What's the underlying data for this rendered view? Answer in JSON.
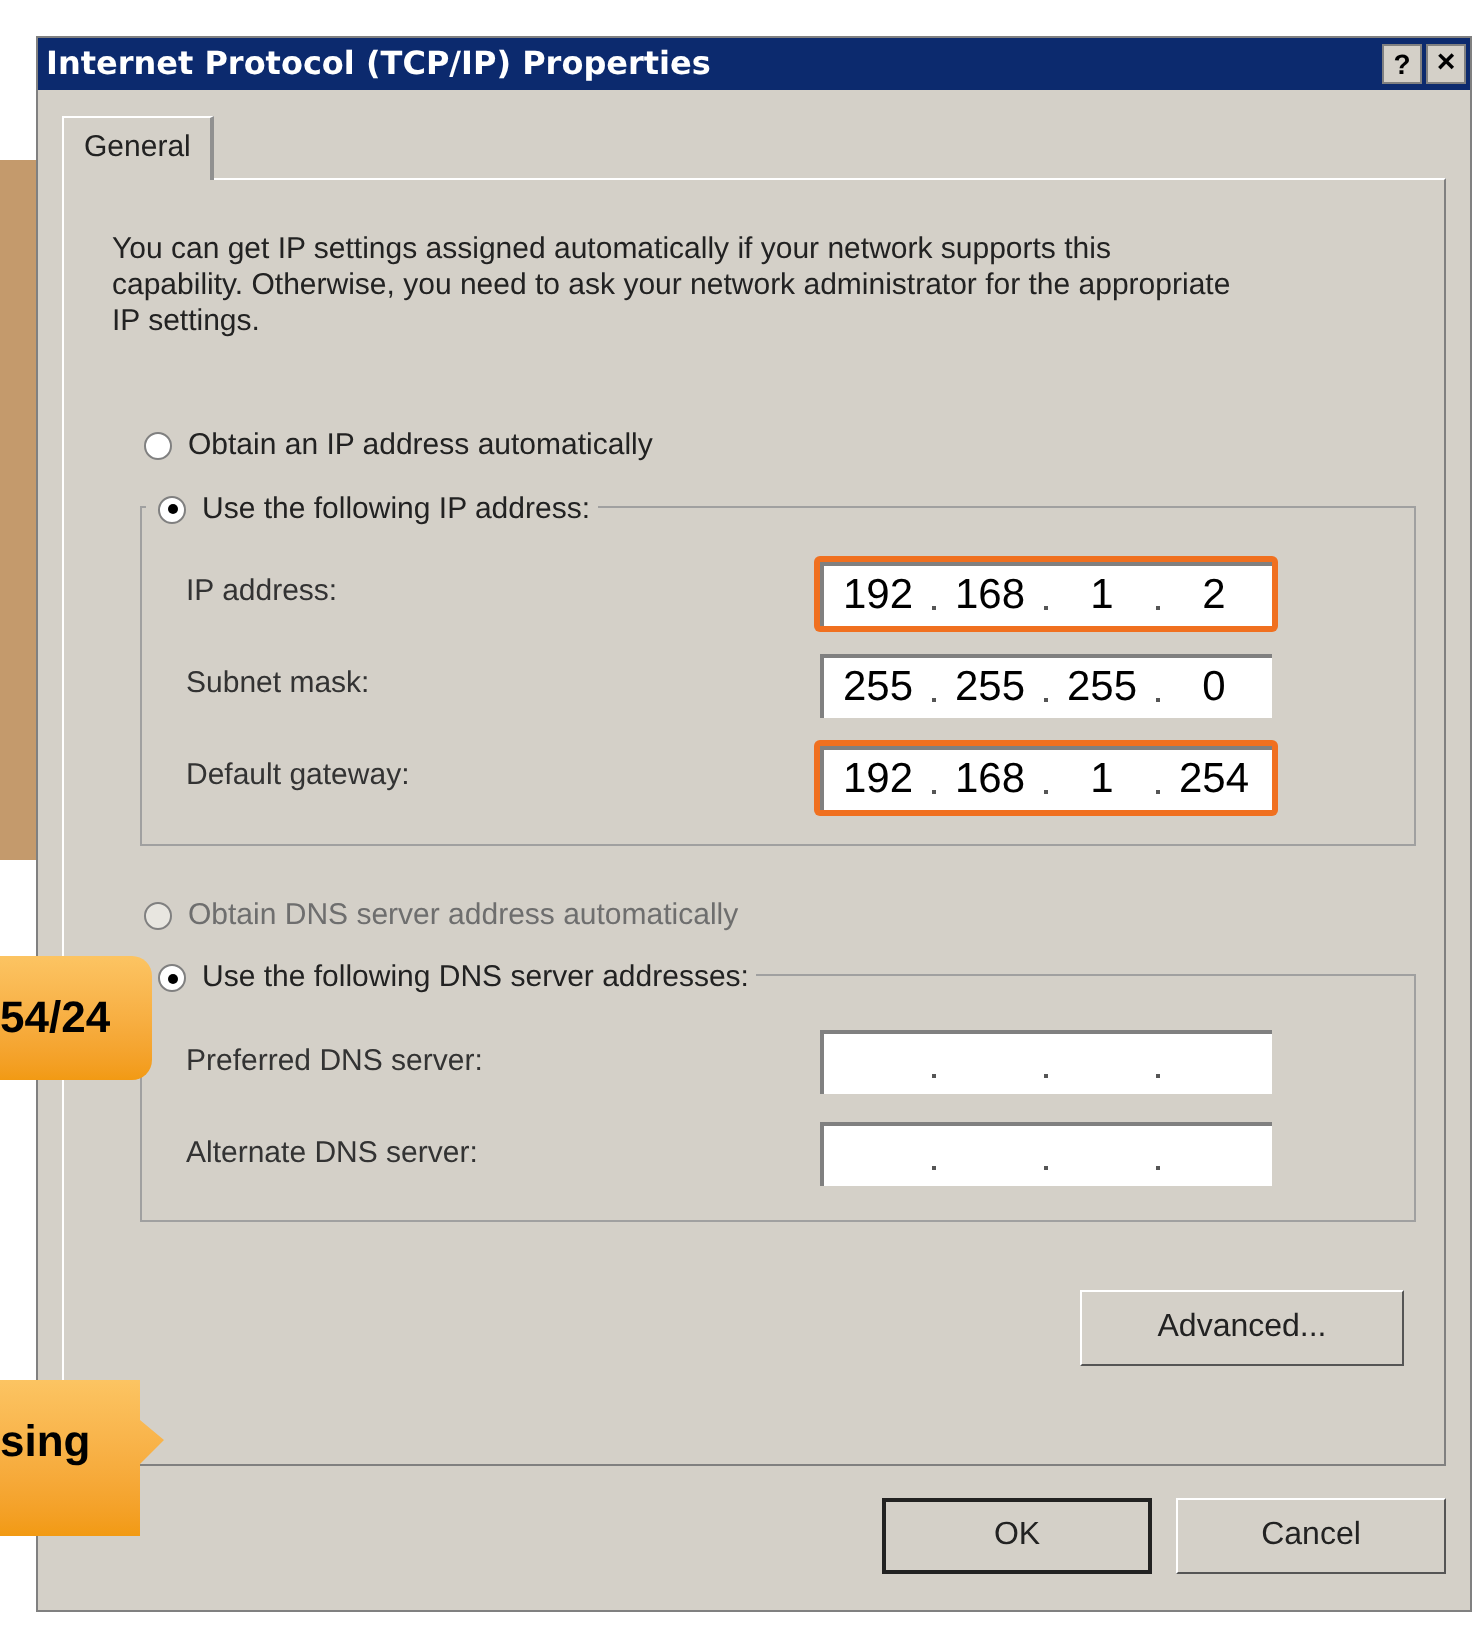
{
  "window": {
    "title": "Internet Protocol (TCP/IP) Properties",
    "help_button": "?",
    "close_button": "×"
  },
  "tabs": [
    {
      "label": "General",
      "selected": true
    }
  ],
  "description": "You can get IP settings assigned automatically if your network supports this capability. Otherwise, you need to ask your network administrator for the appropriate IP settings.",
  "ip_section": {
    "options": [
      {
        "label": "Obtain an IP address automatically",
        "selected": false,
        "disabled": false
      },
      {
        "label": "Use the following IP address:",
        "selected": true,
        "disabled": false
      }
    ],
    "fields": [
      {
        "label": "IP address:",
        "octets": [
          "192",
          "168",
          "1",
          "2"
        ],
        "highlighted": true
      },
      {
        "label": "Subnet mask:",
        "octets": [
          "255",
          "255",
          "255",
          "0"
        ],
        "highlighted": false
      },
      {
        "label": "Default gateway:",
        "octets": [
          "192",
          "168",
          "1",
          "254"
        ],
        "highlighted": true
      }
    ]
  },
  "dns_section": {
    "options": [
      {
        "label": "Obtain DNS server address automatically",
        "selected": false,
        "disabled": true
      },
      {
        "label": "Use the following DNS server addresses:",
        "selected": true,
        "disabled": false
      }
    ],
    "fields": [
      {
        "label": "Preferred DNS server:",
        "highlighted": false
      },
      {
        "label": "Alternate DNS server:",
        "highlighted": false
      }
    ]
  },
  "advanced_button": "Advanced...",
  "buttons": [
    {
      "label": "OK",
      "default": true
    },
    {
      "label": "Cancel",
      "default": false
    }
  ],
  "callouts": [
    {
      "text": "54/24",
      "kind": "pointer"
    },
    {
      "text": "sing",
      "kind": "speech"
    }
  ]
}
